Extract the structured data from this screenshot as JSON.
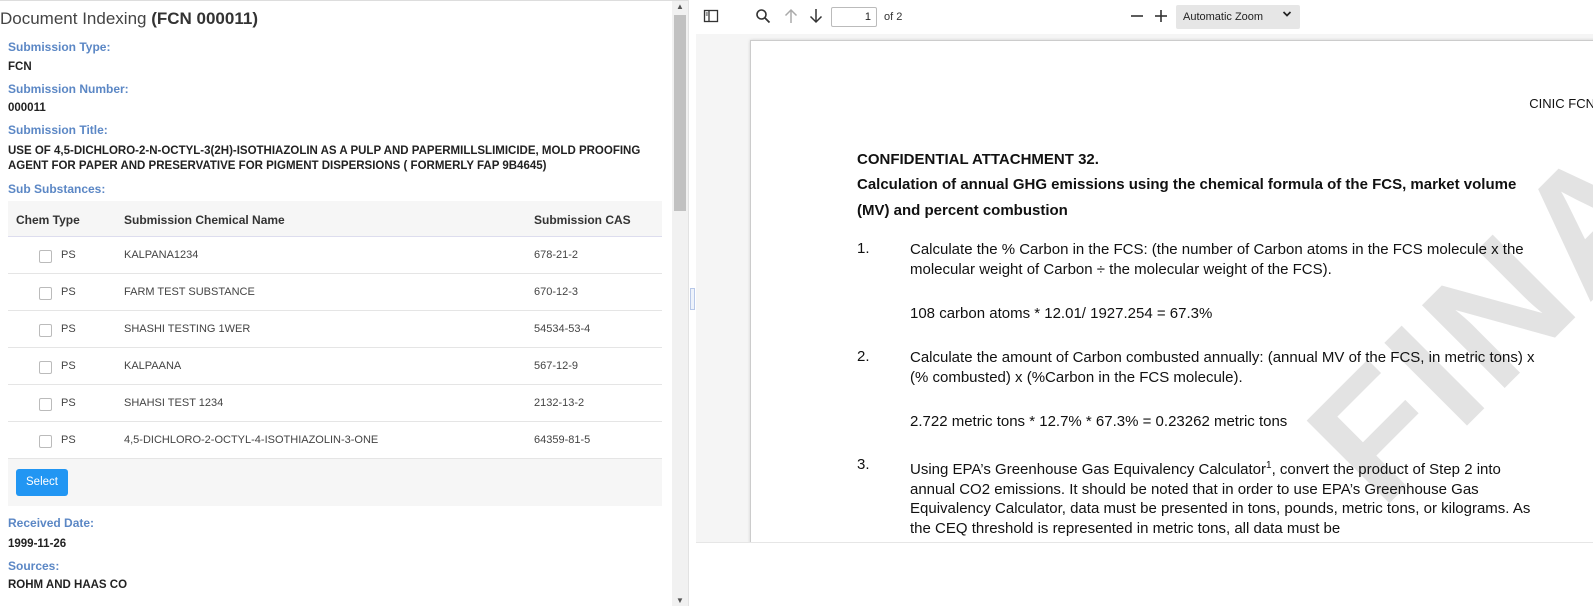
{
  "left": {
    "title_prefix": "Document Indexing ",
    "title_bold": "(FCN 000011)",
    "submission_type_label": "Submission Type:",
    "submission_type_value": "FCN",
    "submission_number_label": "Submission Number:",
    "submission_number_value": "000011",
    "submission_title_label": "Submission Title:",
    "submission_title_value": "USE OF 4,5-DICHLORO-2-N-OCTYL-3(2H)-ISOTHIAZOLIN AS A PULP AND PAPERMILLSLIMICIDE, MOLD PROOFING AGENT FOR PAPER AND PRESERVATIVE FOR PIGMENT DISPERSIONS ( FORMERLY FAP 9B4645)",
    "sub_substances_label": "Sub Substances:",
    "table": {
      "headers": [
        "Chem Type",
        "Submission Chemical Name",
        "Submission CAS"
      ],
      "rows": [
        {
          "chem_type": "PS",
          "name": "KALPANA1234",
          "cas": "678-21-2"
        },
        {
          "chem_type": "PS",
          "name": "FARM TEST SUBSTANCE",
          "cas": "670-12-3"
        },
        {
          "chem_type": "PS",
          "name": "SHASHI TESTING 1WER",
          "cas": "54534-53-4"
        },
        {
          "chem_type": "PS",
          "name": "KALPAANA",
          "cas": "567-12-9"
        },
        {
          "chem_type": "PS",
          "name": "SHAHSI TEST 1234",
          "cas": "2132-13-2"
        },
        {
          "chem_type": "PS",
          "name": "4,5-DICHLORO-2-OCTYL-4-ISOTHIAZOLIN-3-ONE",
          "cas": "64359-81-5"
        }
      ],
      "select_label": "Select"
    },
    "received_date_label": "Received Date:",
    "received_date_value": "1999-11-26",
    "sources_label": "Sources:",
    "sources_value": "ROHM AND HAAS CO"
  },
  "pdf_toolbar": {
    "sidebar_icon": "sidebar-toggle-icon",
    "search_icon": "search-icon",
    "prev_icon": "arrow-up-icon",
    "next_icon": "arrow-down-icon",
    "page_number": "1",
    "of_pages": "of 2",
    "zoom_out_icon": "minus-icon",
    "zoom_in_icon": "plus-icon",
    "zoom_value": "Automatic Zoom"
  },
  "pdf_page": {
    "header": "CINIC FCN",
    "watermark": "FINAL",
    "heading": "CONFIDENTIAL ATTACHMENT 32.",
    "subheading_line1": "Calculation of annual GHG emissions using the chemical formula of the FCS, market volume",
    "subheading_line2": "(MV) and percent combustion",
    "item1_num": "1.",
    "item1_text": "Calculate the % Carbon in the FCS:  (the number of Carbon atoms in the FCS molecule x the molecular weight of Carbon ÷ the molecular weight of the FCS).",
    "item1_calc": "108 carbon atoms * 12.01/ 1927.254 = 67.3%",
    "item2_num": "2.",
    "item2_text": "Calculate the amount of Carbon combusted annually:  (annual MV of the FCS, in metric tons) x (% combusted) x (%Carbon in the FCS molecule).",
    "item2_calc": "2.722 metric tons * 12.7% * 67.3% = 0.23262 metric tons",
    "item3_num": "3.",
    "item3_text_a": "Using EPA’s Greenhouse Gas Equivalency Calculator",
    "item3_sup": "1",
    "item3_text_b": ", convert the product of Step 2 into annual CO2 emissions.  It should be noted that in order to use EPA’s Greenhouse Gas Equivalency Calculator, data must be presented in tons, pounds, metric tons, or kilograms.  As the CEQ threshold is represented in metric tons, all data must be"
  }
}
